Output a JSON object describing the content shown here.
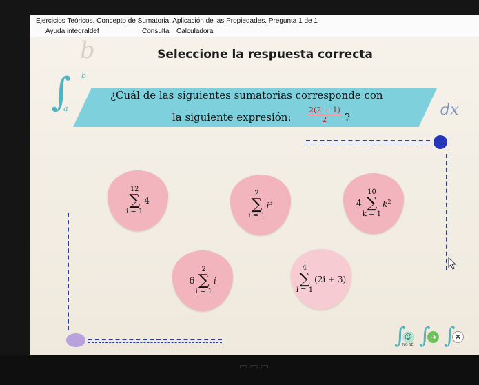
{
  "window": {
    "title": "Ejercicios Teóricos. Concepto de Sumatoria. Aplicación de las Propiedades. Pregunta 1 de 1"
  },
  "menu": {
    "items": [
      "Ayuda integraldef",
      "Consulta",
      "Calculadora"
    ]
  },
  "heading": "Seleccione la respuesta correcta",
  "decor": {
    "b_letter": "b",
    "integral_upper": "b",
    "integral_lower": "a",
    "dx": "dx"
  },
  "question": {
    "line1": "¿Cuál de las siguientes sumatorias corresponde con",
    "line2": "la siguiente expresión:",
    "fraction_num": "2(2 + 1)",
    "fraction_den": "2",
    "end": "?"
  },
  "options": [
    {
      "id": "opt-a",
      "top": "12",
      "bottom": "i = 1",
      "coef": "",
      "term": "4",
      "term_sup": ""
    },
    {
      "id": "opt-b",
      "top": "2",
      "bottom": "i = 1",
      "coef": "",
      "term": "i",
      "term_sup": "3"
    },
    {
      "id": "opt-c",
      "top": "10",
      "bottom": "k = 1",
      "coef": "4",
      "term": "k",
      "term_sup": "2"
    },
    {
      "id": "opt-d",
      "top": "2",
      "bottom": "i = 1",
      "coef": "6",
      "term": "i",
      "term_sup": ""
    },
    {
      "id": "opt-e",
      "top": "4",
      "bottom": "i = 1",
      "coef": "",
      "term": "(2i + 3)",
      "term_sup": ""
    }
  ],
  "nav": {
    "dont_know_label": "NO SÉ",
    "next_symbol": "➜",
    "exit_symbol": "✕"
  },
  "colors": {
    "banner": "#7fd0dd",
    "option_pink": "#f2b4bd",
    "accent_blue": "#2636b8",
    "fraction_red": "#b02030"
  }
}
